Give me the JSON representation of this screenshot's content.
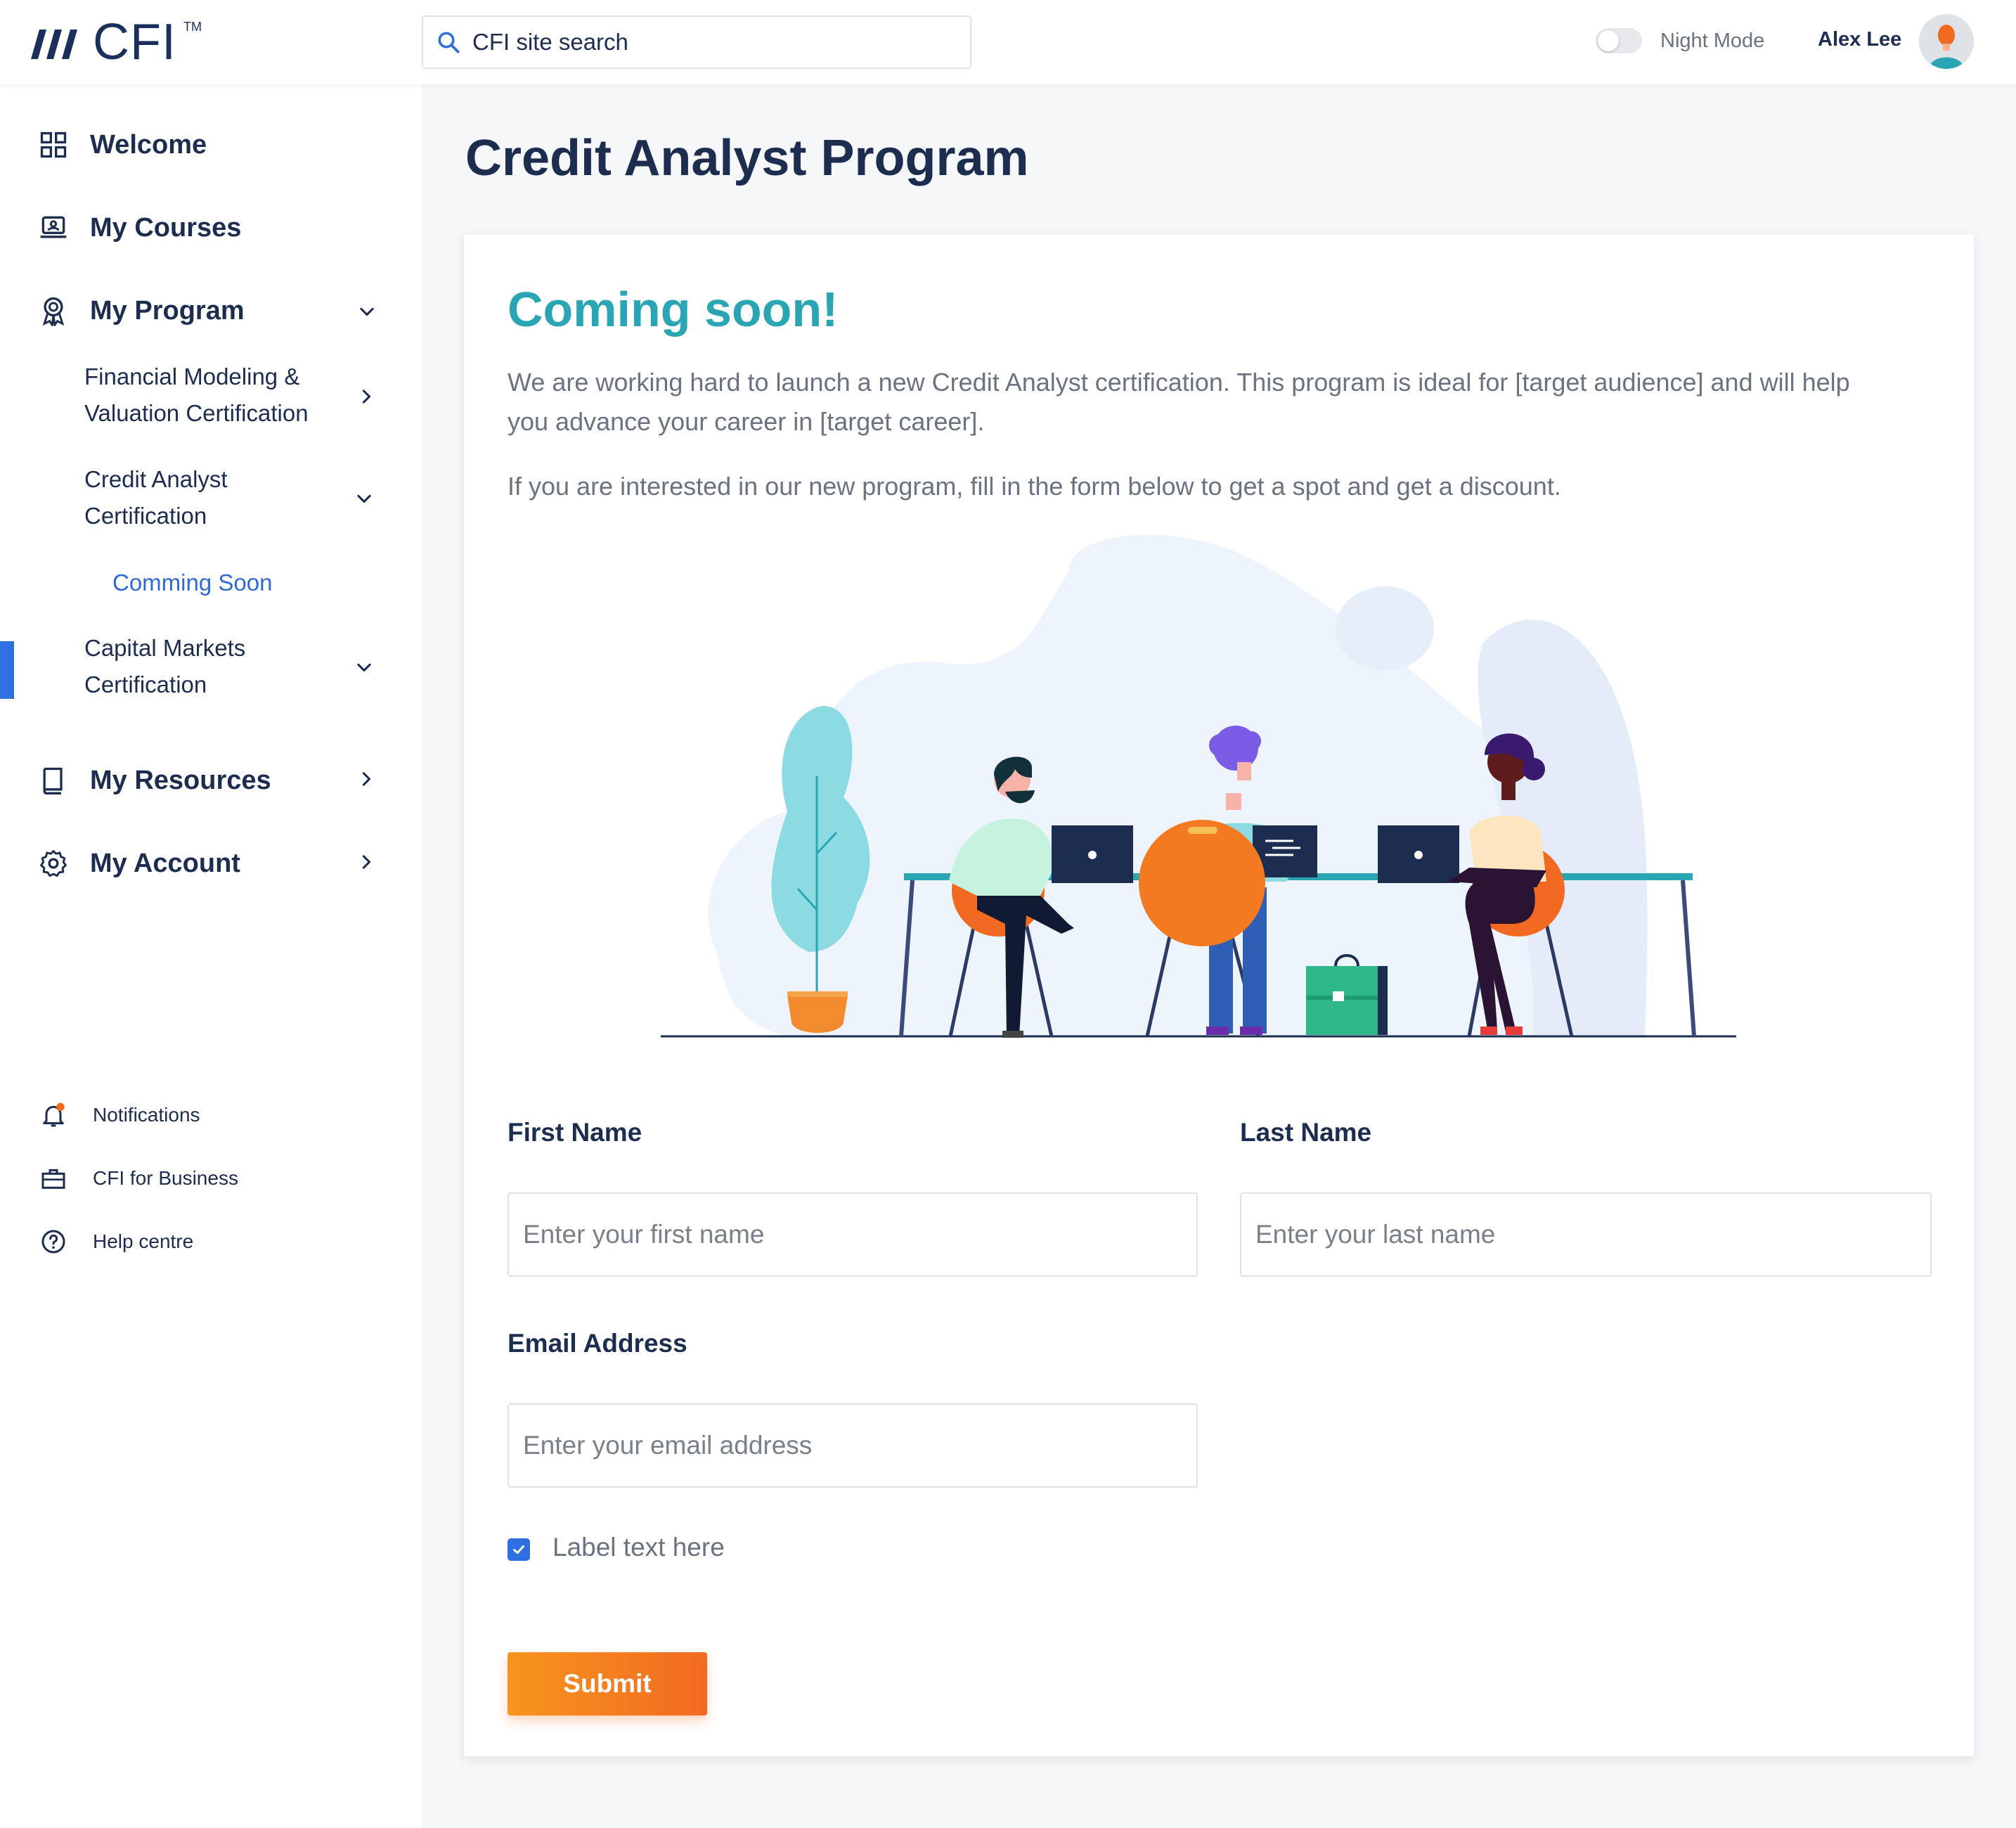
{
  "header": {
    "logo_text": "CFI",
    "logo_tm": "TM",
    "search_placeholder": "CFI site search",
    "night_mode_label": "Night Mode",
    "night_mode_on": false,
    "user_name": "Alex Lee"
  },
  "sidebar": {
    "items": [
      {
        "label": "Welcome",
        "icon": "grid-icon"
      },
      {
        "label": "My Courses",
        "icon": "laptop-icon"
      },
      {
        "label": "My Program",
        "icon": "award-icon"
      },
      {
        "label": "My Resources",
        "icon": "book-icon"
      },
      {
        "label": "My Account",
        "icon": "gear-icon"
      }
    ],
    "program_sub": [
      {
        "label": "Financial Modeling & Valuation Certification"
      },
      {
        "label": "Credit Analyst Certification"
      },
      {
        "label": "Capital Markets Certification"
      }
    ],
    "active_sub": "Comming Soon",
    "footer": [
      {
        "label": "Notifications",
        "icon": "bell-icon"
      },
      {
        "label": "CFI for Business",
        "icon": "briefcase-icon"
      },
      {
        "label": "Help centre",
        "icon": "help-icon"
      }
    ]
  },
  "main": {
    "page_title": "Credit Analyst Program",
    "heading": "Coming soon!",
    "description": "We are working hard to launch a new Credit Analyst certification. This program is ideal for [target audience] and will help you advance your career in [target career].",
    "description2": "If you are interested in our new program, fill in the form below to get a spot and get a discount.",
    "form": {
      "first_name_label": "First Name",
      "first_name_placeholder": "Enter your first name",
      "last_name_label": "Last Name",
      "last_name_placeholder": "Enter your last name",
      "email_label": "Email Address",
      "email_placeholder": "Enter your email address",
      "checkbox_label": "Label text here",
      "checkbox_checked": true,
      "submit_label": "Submit"
    }
  },
  "colors": {
    "accent_blue": "#2f6fdf",
    "heading_teal": "#2aa5b3",
    "submit_orange": "#f26a21",
    "navy": "#1c2d4f"
  }
}
